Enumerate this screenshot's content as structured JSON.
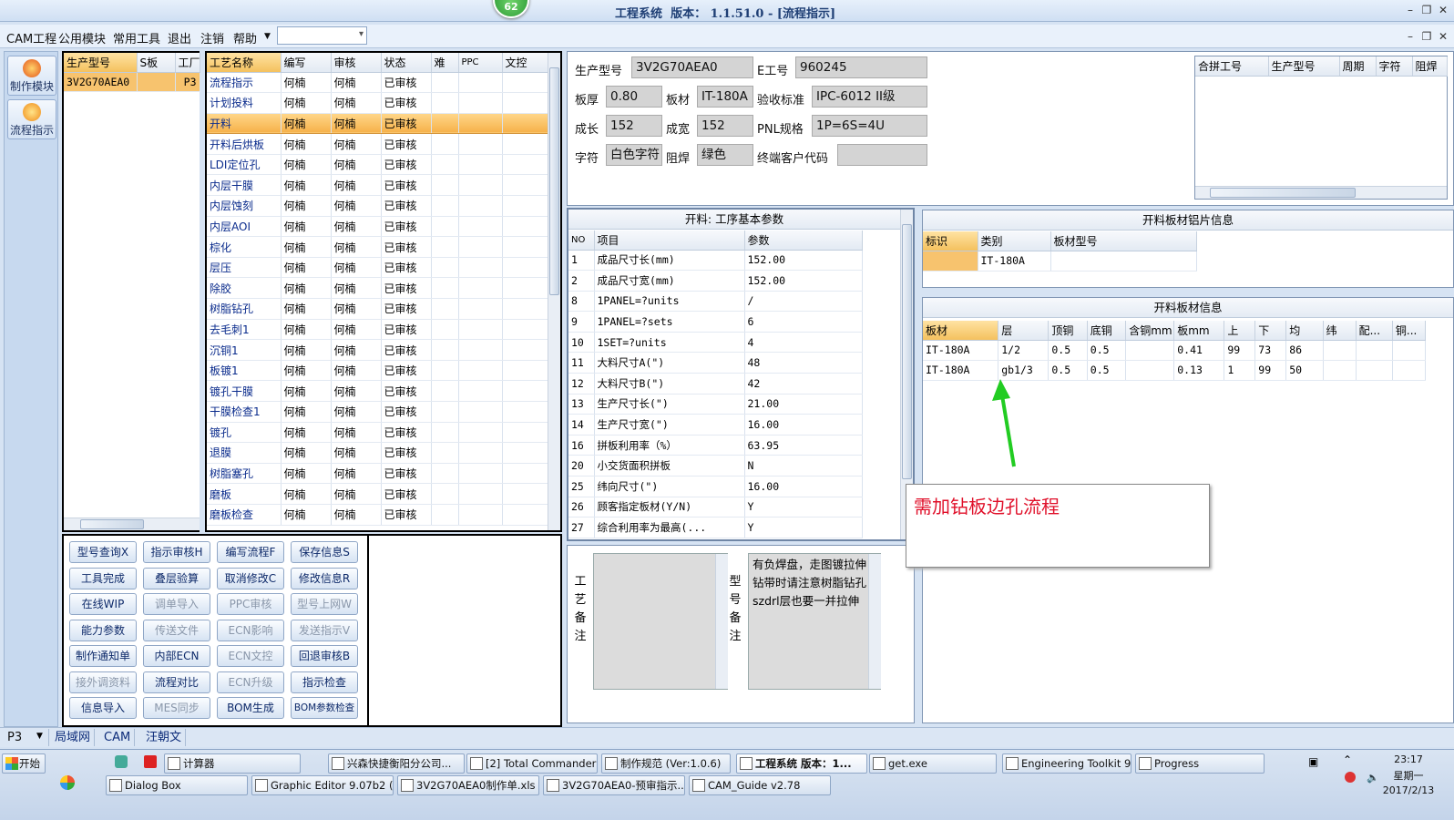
{
  "title": {
    "app": "工程系统",
    "version_label": "版本：",
    "version": "1.1.51.0",
    "suffix": "- [流程指示]",
    "badge": "62"
  },
  "menu": [
    "CAM工程",
    "公用模块",
    "常用工具",
    "退出",
    "注销",
    "帮助"
  ],
  "leftbar": [
    {
      "label": "制作模块",
      "icon": "gear-orange-icon"
    },
    {
      "label": "流程指示",
      "icon": "flow-orange-icon"
    }
  ],
  "model_list": {
    "headers": [
      "生产型号",
      "S板",
      "工厂"
    ],
    "rows": [
      [
        "3V2G70AEA0",
        "",
        "P3"
      ]
    ]
  },
  "process": {
    "headers": [
      "工艺名称",
      "编写",
      "审核",
      "状态",
      "难",
      "PPC",
      "文控"
    ],
    "rows": [
      [
        "流程指示",
        "何楠",
        "何楠",
        "已审核"
      ],
      [
        "计划投料",
        "何楠",
        "何楠",
        "已审核"
      ],
      [
        "开料",
        "何楠",
        "何楠",
        "已审核"
      ],
      [
        "开料后烘板",
        "何楠",
        "何楠",
        "已审核"
      ],
      [
        "LDI定位孔",
        "何楠",
        "何楠",
        "已审核"
      ],
      [
        "内层干膜",
        "何楠",
        "何楠",
        "已审核"
      ],
      [
        "内层蚀刻",
        "何楠",
        "何楠",
        "已审核"
      ],
      [
        "内层AOI",
        "何楠",
        "何楠",
        "已审核"
      ],
      [
        "棕化",
        "何楠",
        "何楠",
        "已审核"
      ],
      [
        "层压",
        "何楠",
        "何楠",
        "已审核"
      ],
      [
        "除胶",
        "何楠",
        "何楠",
        "已审核"
      ],
      [
        "树脂钻孔",
        "何楠",
        "何楠",
        "已审核"
      ],
      [
        "去毛刺1",
        "何楠",
        "何楠",
        "已审核"
      ],
      [
        "沉铜1",
        "何楠",
        "何楠",
        "已审核"
      ],
      [
        "板镀1",
        "何楠",
        "何楠",
        "已审核"
      ],
      [
        "镀孔干膜",
        "何楠",
        "何楠",
        "已审核"
      ],
      [
        "干膜检查1",
        "何楠",
        "何楠",
        "已审核"
      ],
      [
        "镀孔",
        "何楠",
        "何楠",
        "已审核"
      ],
      [
        "退膜",
        "何楠",
        "何楠",
        "已审核"
      ],
      [
        "树脂塞孔",
        "何楠",
        "何楠",
        "已审核"
      ],
      [
        "磨板",
        "何楠",
        "何楠",
        "已审核"
      ],
      [
        "磨板检查",
        "何楠",
        "何楠",
        "已审核"
      ]
    ]
  },
  "buttons": [
    [
      {
        "t": "型号查询X",
        "d": false
      },
      {
        "t": "指示审核H",
        "d": false
      },
      {
        "t": "编写流程F",
        "d": false
      },
      {
        "t": "保存信息S",
        "d": false
      }
    ],
    [
      {
        "t": "工具完成",
        "d": false
      },
      {
        "t": "叠层验算",
        "d": false
      },
      {
        "t": "取消修改C",
        "d": false
      },
      {
        "t": "修改信息R",
        "d": false
      }
    ],
    [
      {
        "t": "在线WIP",
        "d": false
      },
      {
        "t": "调单导入",
        "d": true
      },
      {
        "t": "PPC审核",
        "d": true
      },
      {
        "t": "型号上网W",
        "d": true
      }
    ],
    [
      {
        "t": "能力参数",
        "d": false
      },
      {
        "t": "传送文件",
        "d": true
      },
      {
        "t": "ECN影响",
        "d": true
      },
      {
        "t": "发送指示V",
        "d": true
      }
    ],
    [
      {
        "t": "制作通知单",
        "d": false
      },
      {
        "t": "内部ECN",
        "d": false
      },
      {
        "t": "ECN文控",
        "d": true
      },
      {
        "t": "回退审核B",
        "d": false
      }
    ],
    [
      {
        "t": "接外调资料",
        "d": true
      },
      {
        "t": "流程对比",
        "d": false
      },
      {
        "t": "ECN升级",
        "d": true
      },
      {
        "t": "指示检查",
        "d": false
      }
    ],
    [
      {
        "t": "信息导入",
        "d": false
      },
      {
        "t": "MES同步",
        "d": true
      },
      {
        "t": "BOM生成",
        "d": false
      },
      {
        "t": "BOM参数检查",
        "d": false
      }
    ]
  ],
  "info": {
    "prod_model_label": "生产型号",
    "prod_model": "3V2G70AEA0",
    "e_no_label": "E工号",
    "e_no": "960245",
    "thick_label": "板厚",
    "thick": "0.80",
    "mat_label": "板材",
    "mat": "IT-180A",
    "std_label": "验收标准",
    "std": "IPC-6012 II级",
    "len_label": "成长",
    "len": "152",
    "wid_label": "成宽",
    "wid": "152",
    "pnl_label": "PNL规格",
    "pnl": "1P=6S=4U",
    "char_label": "字符",
    "char": "白色字符",
    "mask_label": "阻焊",
    "mask": "绿色",
    "cust_label": "终端客户代码",
    "cust": ""
  },
  "merge_table": {
    "headers": [
      "合拼工号",
      "生产型号",
      "周期",
      "字符",
      "阻焊"
    ]
  },
  "params": {
    "title": "开料: 工序基本参数",
    "headers": [
      "NO",
      "项目",
      "参数"
    ],
    "rows": [
      [
        "1",
        "成品尺寸长(mm)",
        "152.00"
      ],
      [
        "2",
        "成品尺寸宽(mm)",
        "152.00"
      ],
      [
        "8",
        "1PANEL=?units",
        "/"
      ],
      [
        "9",
        "1PANEL=?sets",
        "6"
      ],
      [
        "10",
        "1SET=?units",
        "4"
      ],
      [
        "11",
        "大料尺寸A(\")",
        "48"
      ],
      [
        "12",
        "大料尺寸B(\")",
        "42"
      ],
      [
        "13",
        "生产尺寸长(\")",
        "21.00"
      ],
      [
        "14",
        "生产尺寸宽(\")",
        "16.00"
      ],
      [
        "16",
        "拼板利用率（%）",
        "63.95"
      ],
      [
        "20",
        "小交货面积拼板",
        "N"
      ],
      [
        "25",
        "纬向尺寸(\")",
        "16.00"
      ],
      [
        "26",
        "顾客指定板材(Y/N)",
        "Y"
      ],
      [
        "27",
        "综合利用率为最高(...",
        "Y"
      ]
    ]
  },
  "sheet_info": {
    "title": "开料板材铝片信息",
    "headers": [
      "标识",
      "类别",
      "板材型号"
    ],
    "rows": [
      [
        "",
        "IT-180A",
        ""
      ]
    ]
  },
  "board_info": {
    "title": "开料板材信息",
    "headers": [
      "板材",
      "层",
      "顶铜",
      "底铜",
      "含铜mm",
      "板mm",
      "上",
      "下",
      "均",
      "纬",
      "配...",
      "铜..."
    ],
    "rows": [
      [
        "IT-180A",
        "1/2",
        "0.5",
        "0.5",
        "",
        "0.41",
        "99",
        "73",
        "86",
        "",
        "",
        ""
      ],
      [
        "IT-180A",
        "gb1/3",
        "0.5",
        "0.5",
        "",
        "0.13",
        "1",
        "99",
        "50",
        "",
        "",
        ""
      ]
    ]
  },
  "remarks": {
    "process_label": "工艺备注",
    "process_text": "",
    "model_label": "型号备注",
    "model_text": "有负焊盘，走图镀拉伸钻带时请注意树脂钻孔szdrl层也要一并拉伸"
  },
  "annotation": {
    "text": "需加钻板边孔流程",
    "arrow_color": "#22cc22"
  },
  "status": {
    "site": "P3",
    "tabs": [
      "局域网",
      "CAM",
      "汪朝文"
    ]
  },
  "taskbar": {
    "start": "开始",
    "row1": [
      "计算器",
      "兴森快捷衡阳分公司...",
      "[2] Total Commander ...",
      "制作规范 (Ver:1.0.6)",
      "工程系统 版本：1...",
      "get.exe",
      "Engineering Toolkit 9....",
      "Progress"
    ],
    "row2": [
      "Dialog Box",
      "Graphic Editor 9.07b2 (0...",
      "3V2G70AEA0制作单.xls ...",
      "3V2G70AEA0-预审指示....",
      "CAM_Guide v2.78"
    ],
    "time": "23:17",
    "weekday": "星期一",
    "date": "2017/2/13"
  },
  "colors": {
    "accent": "#f6b14a",
    "panel_bg": "#d6e3f3",
    "note_text": "#e0102a"
  }
}
